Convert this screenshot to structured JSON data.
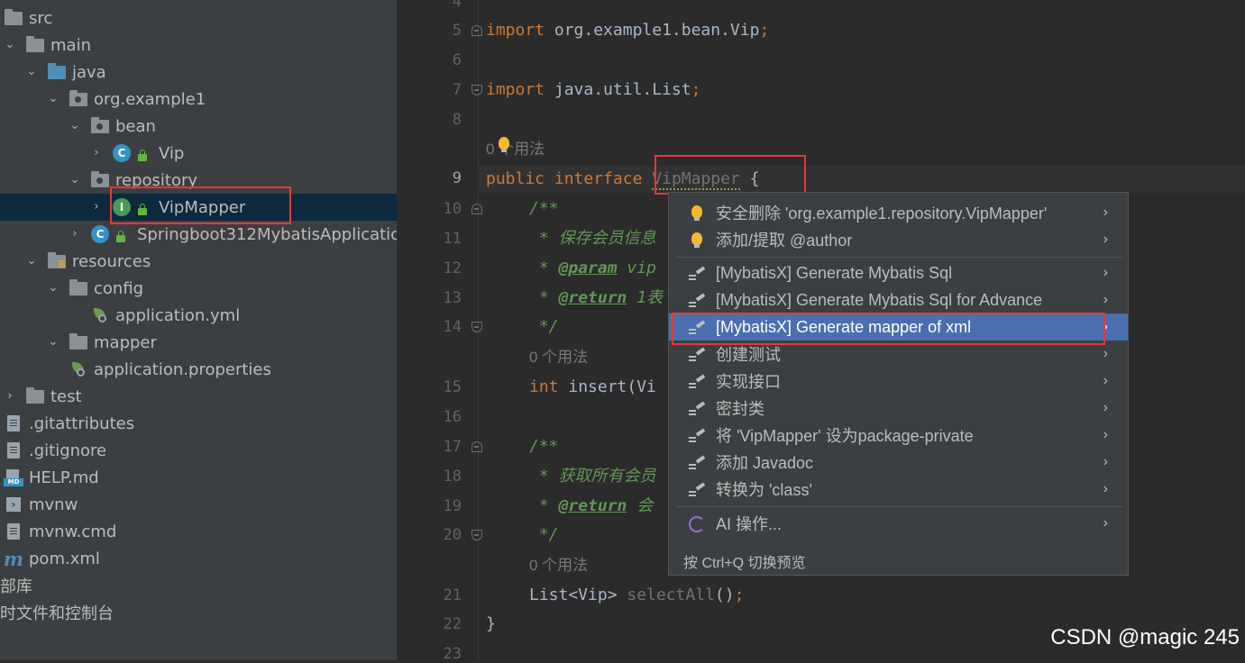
{
  "project_tree": {
    "items": [
      {
        "label": "src",
        "chevron": "",
        "icon": "folder-icon"
      },
      {
        "label": "main",
        "chevron": "expanded",
        "icon": "folder-icon"
      },
      {
        "label": "java",
        "chevron": "expanded",
        "icon": "source-folder-icon"
      },
      {
        "label": "org.example1",
        "chevron": "expanded",
        "icon": "package-icon"
      },
      {
        "label": "bean",
        "chevron": "expanded",
        "icon": "package-icon"
      },
      {
        "label": "Vip",
        "chevron": "collapsed",
        "icon": "class-icon"
      },
      {
        "label": "repository",
        "chevron": "expanded",
        "icon": "package-icon"
      },
      {
        "label": "VipMapper",
        "chevron": "collapsed",
        "icon": "interface-icon",
        "selected": true
      },
      {
        "label": "Springboot312MybatisApplicatic",
        "chevron": "collapsed",
        "icon": "spring-class-icon"
      },
      {
        "label": "resources",
        "chevron": "expanded",
        "icon": "resources-folder-icon"
      },
      {
        "label": "config",
        "chevron": "expanded",
        "icon": "folder-icon"
      },
      {
        "label": "application.yml",
        "chevron": "",
        "icon": "spring-config-icon"
      },
      {
        "label": "mapper",
        "chevron": "expanded",
        "icon": "folder-icon"
      },
      {
        "label": "application.properties",
        "chevron": "",
        "icon": "spring-config-icon"
      },
      {
        "label": "test",
        "chevron": "collapsed",
        "icon": "folder-icon"
      },
      {
        "label": ".gitattributes",
        "chevron": "",
        "icon": "text-file-icon"
      },
      {
        "label": ".gitignore",
        "chevron": "",
        "icon": "gitignore-file-icon"
      },
      {
        "label": "HELP.md",
        "chevron": "",
        "icon": "markdown-file-icon"
      },
      {
        "label": "mvnw",
        "chevron": "",
        "icon": "shell-file-icon"
      },
      {
        "label": "mvnw.cmd",
        "chevron": "",
        "icon": "text-file-icon"
      },
      {
        "label": "pom.xml",
        "chevron": "",
        "icon": "maven-icon"
      },
      {
        "label": "部库",
        "chevron": "",
        "icon": ""
      },
      {
        "label": "时文件和控制台",
        "chevron": "",
        "icon": ""
      }
    ]
  },
  "editor": {
    "line_numbers": [
      "4",
      "5",
      "6",
      "7",
      "8",
      "9",
      "10",
      "11",
      "12",
      "13",
      "14",
      "15",
      "16",
      "17",
      "18",
      "19",
      "20",
      "21",
      "22",
      "23"
    ],
    "active_line": "9",
    "code": {
      "l5_kw": "import",
      "l5_rest": " org.example1.bean.Vip",
      "l5_semi": ";",
      "l7_kw": "import",
      "l7_rest": " java.util.List",
      "l7_semi": ";",
      "usage_hint_1": "0 个用法",
      "l9_kw1": "public",
      "l9_kw2": "interface",
      "l9_name": "VipMapper",
      "l9_brace": "{",
      "l10": "/**",
      "l11": " * 保存会员信息",
      "l12_star": " * ",
      "l12_tag": "@param",
      "l12_rest": " vip",
      "l13_star": " * ",
      "l13_tag": "@return",
      "l13_rest": " 1表",
      "l14": " */",
      "usage_hint_2": "0 个用法",
      "l15_kw": "int",
      "l15_rest": " insert(Vi",
      "l17": "/**",
      "l18": " * 获取所有会员",
      "l19_star": " * ",
      "l19_tag": "@return",
      "l19_rest": " 会",
      "l20": " */",
      "usage_hint_3": "0 个用法",
      "l21_type": "List<Vip> ",
      "l21_method": "selectAll",
      "l21_paren": "()",
      "l21_semi": ";",
      "l22": "}"
    }
  },
  "context_menu": {
    "items": [
      {
        "label": "安全删除 'org.example1.repository.VipMapper'",
        "icon": "bulb-icon",
        "selected": false
      },
      {
        "label": "添加/提取 @author",
        "icon": "bulb-icon",
        "selected": false
      },
      {
        "label": "[MybatisX] Generate Mybatis Sql",
        "icon": "intention-pencil-icon",
        "selected": false
      },
      {
        "label": "[MybatisX] Generate Mybatis Sql for Advance",
        "icon": "intention-pencil-icon",
        "selected": false
      },
      {
        "label": "[MybatisX] Generate mapper of xml",
        "icon": "intention-pencil-icon",
        "selected": true
      },
      {
        "label": "创建测试",
        "icon": "intention-pencil-icon",
        "selected": false
      },
      {
        "label": "实现接口",
        "icon": "intention-pencil-icon",
        "selected": false
      },
      {
        "label": "密封类",
        "icon": "intention-pencil-icon",
        "selected": false
      },
      {
        "label": "将 'VipMapper' 设为package-private",
        "icon": "intention-pencil-icon",
        "selected": false
      },
      {
        "label": "添加 Javadoc",
        "icon": "intention-pencil-icon",
        "selected": false
      },
      {
        "label": "转换为 'class'",
        "icon": "intention-pencil-icon",
        "selected": false
      },
      {
        "label": "AI 操作...",
        "icon": "ai-assistant-icon",
        "selected": false
      }
    ],
    "submenu_arrow": "›",
    "footer": "按 Ctrl+Q 切换预览"
  },
  "colors": {
    "selection": "#4b6eaf",
    "highlight_box": "#e53935",
    "keyword": "#cc7832",
    "comment": "#629755"
  },
  "watermark": "CSDN @magic 245"
}
